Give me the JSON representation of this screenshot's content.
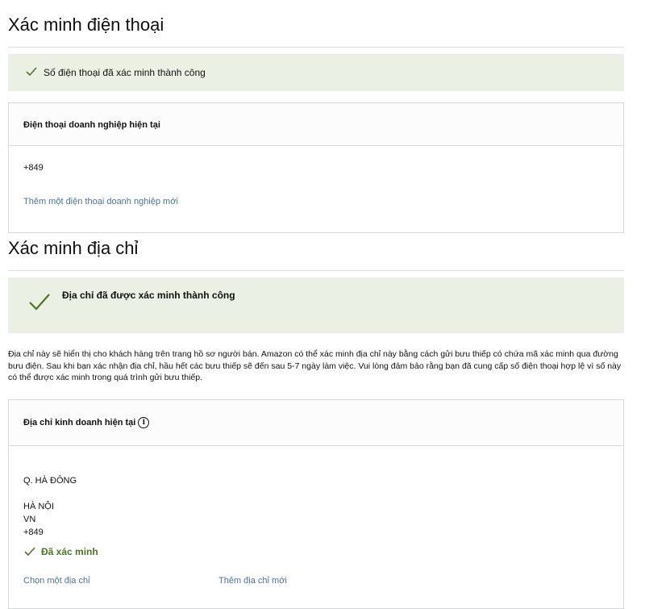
{
  "phone_section": {
    "title": "Xác minh điện thoại",
    "alert_text": "Số điện thoại đã xác minh thành công",
    "box_header": "Điện thoại doanh nghiệp hiện tại",
    "phone_value": "+849",
    "add_link": "Thêm một điện thoại doanh nghiệp mới"
  },
  "address_section": {
    "title": "Xác minh địa chỉ",
    "alert_text": "Địa chỉ đã được xác minh thành công",
    "description": "Địa chỉ này sẽ hiển thị cho khách hàng trên trang hồ sơ người bán. Amazon có thể xác minh địa chỉ này bằng cách gửi bưu thiếp có chứa mã xác minh qua đường bưu điện. Sau khi bạn xác nhận địa chỉ, hầu hết các bưu thiếp sẽ đến sau 5-7 ngày làm việc. Vui lòng đảm bảo rằng bạn đã cung cấp số điện thoại hợp lệ vì số này có thể được xác minh trong quá trình gửi bưu thiếp.",
    "box_header": "Địa chỉ kinh doanh hiện tại",
    "info_icon_glyph": "i",
    "address_lines": {
      "district": "Q. HÀ ĐÔNG",
      "city": "HÀ NỘI",
      "country": "VN",
      "phone": "+849"
    },
    "verified_label": "Đã xác minh",
    "choose_link": "Chọn một địa chỉ",
    "add_link": "Thêm địa chỉ mới"
  },
  "colors": {
    "success_bg": "#ebf0e4",
    "success_check": "#507325",
    "link": "#4b7399"
  },
  "icons": {
    "phone_alert_icon": "check-icon",
    "address_alert_icon": "check-icon",
    "info_icon": "info-icon",
    "verified_icon": "check-icon"
  }
}
